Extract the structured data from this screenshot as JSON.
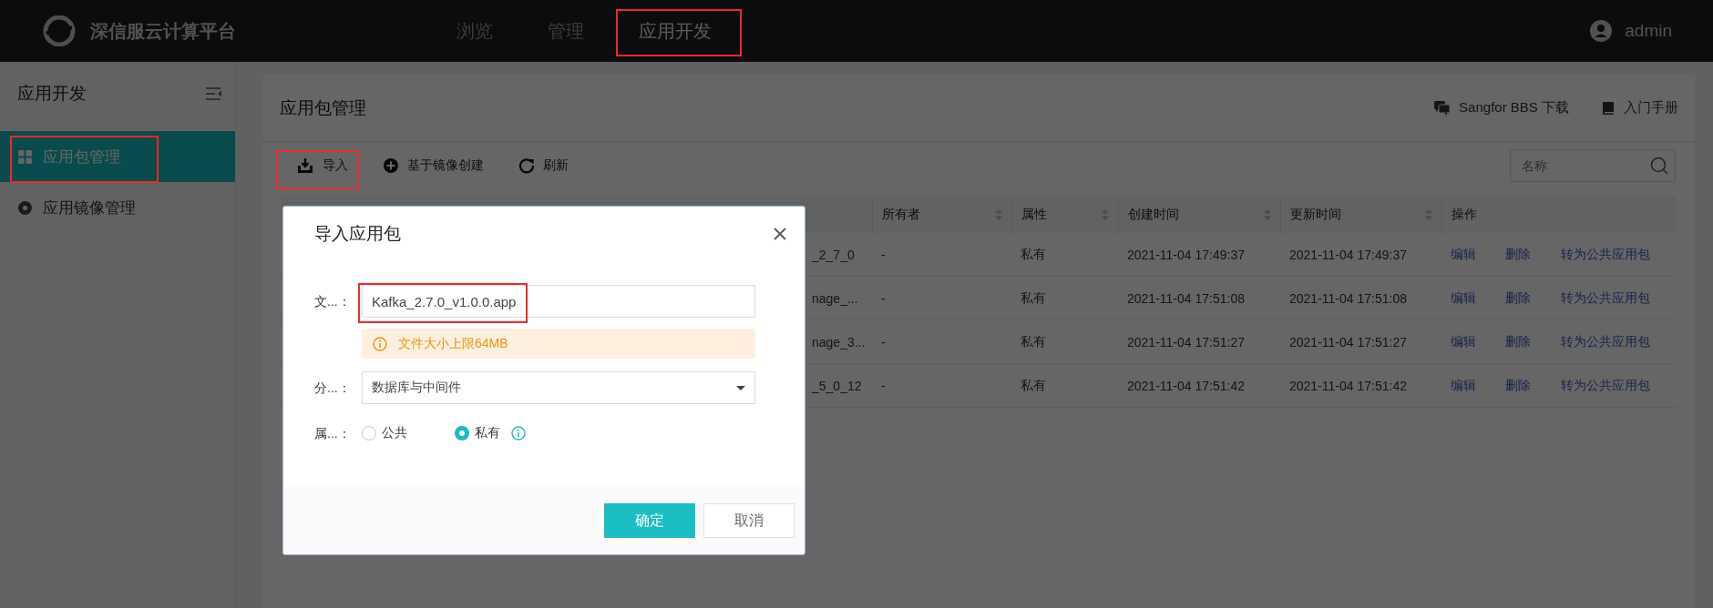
{
  "topbar": {
    "brand": "深信服云计算平台",
    "nav": [
      {
        "label": "浏览",
        "selected": false
      },
      {
        "label": "管理",
        "selected": false
      },
      {
        "label": "应用开发",
        "selected": true
      }
    ],
    "user": "admin"
  },
  "sidebar": {
    "title": "应用开发",
    "items": [
      {
        "label": "应用包管理",
        "selected": true
      },
      {
        "label": "应用镜像管理",
        "selected": false
      }
    ]
  },
  "panel": {
    "title": "应用包管理",
    "links": [
      "Sangfor BBS 下载",
      "入门手册"
    ],
    "toolbar": [
      "导入",
      "基于镜像创建",
      "刷新"
    ],
    "search": {
      "placeholder": "名称"
    },
    "table": {
      "columns": [
        "所有者",
        "属性",
        "创建时间",
        "更新时间",
        "操作"
      ],
      "rows": [
        {
          "name": "_2_7_0",
          "owner": "-",
          "attribute": "私有",
          "created": "2021-11-04 17:49:37",
          "updated": "2021-11-04 17:49:37",
          "actions": [
            "编辑",
            "删除",
            "转为公共应用包"
          ]
        },
        {
          "name": "nage_...",
          "owner": "-",
          "attribute": "私有",
          "created": "2021-11-04 17:51:08",
          "updated": "2021-11-04 17:51:08",
          "actions": [
            "编辑",
            "删除",
            "转为公共应用包"
          ]
        },
        {
          "name": "nage_3...",
          "owner": "-",
          "attribute": "私有",
          "created": "2021-11-04 17:51:27",
          "updated": "2021-11-04 17:51:27",
          "actions": [
            "编辑",
            "删除",
            "转为公共应用包"
          ]
        },
        {
          "name": "_5_0_12",
          "owner": "-",
          "attribute": "私有",
          "created": "2021-11-04 17:51:42",
          "updated": "2021-11-04 17:51:42",
          "actions": [
            "编辑",
            "删除",
            "转为公共应用包"
          ]
        }
      ]
    }
  },
  "dialog": {
    "title": "导入应用包",
    "fields": [
      {
        "kind": "file",
        "label": "文...：",
        "value": "Kafka_2.7.0_v1.0.0.app",
        "notice": "文件大小上限64MB"
      },
      {
        "kind": "select",
        "label": "分...：",
        "value": "数据库与中间件"
      },
      {
        "kind": "radio",
        "label": "属...：",
        "options": [
          {
            "label": "公共",
            "selected": false
          },
          {
            "label": "私有",
            "selected": true
          }
        ]
      }
    ],
    "buttons": [
      {
        "label": "确定",
        "kind": "primary"
      },
      {
        "label": "取消",
        "kind": "default"
      }
    ]
  }
}
